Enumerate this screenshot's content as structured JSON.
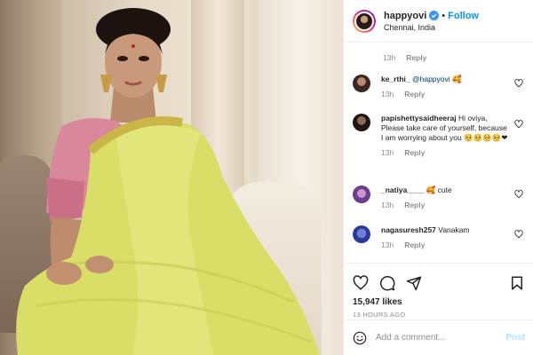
{
  "post": {
    "username": "happyovi",
    "follow_label": "Follow",
    "location": "Chennai, India"
  },
  "comments": {
    "first_meta": {
      "time": "13h",
      "reply": "Reply"
    },
    "items": [
      {
        "user": "ke_rthi_",
        "text": "@happyovi 🥰",
        "time": "13h",
        "reply": "Reply"
      },
      {
        "user": "papishettysaidheeraj",
        "text": "Hi oviya, Please take care of yourself, because I am worrying about you 🥺🥺🥺🥺❤",
        "time": "13h",
        "reply": "Reply"
      },
      {
        "user": "_natiya____",
        "text": "🥰 cute",
        "time": "13h",
        "reply": "Reply"
      },
      {
        "user": "nagasuresh257",
        "text": "Vanakam",
        "time": "13h",
        "reply": "Reply"
      }
    ]
  },
  "stats": {
    "likes": "15,947 likes",
    "time_ago": "13 HOURS AGO"
  },
  "composer": {
    "placeholder": "Add a comment...",
    "post_label": "Post"
  },
  "icons": {
    "verified": "verified-badge-icon",
    "like": "heart-icon",
    "comment": "comment-icon",
    "share": "paper-plane-icon",
    "save": "bookmark-icon",
    "emoji": "smile-icon"
  },
  "colors": {
    "accent": "#0095f6",
    "mention": "#00376b",
    "muted": "#8e8e8e",
    "post_disabled": "#b2dffc",
    "saree": "#d9df66"
  }
}
